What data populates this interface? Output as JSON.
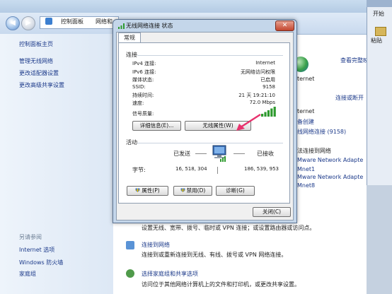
{
  "background_window": {
    "breadcrumb": [
      "控制面板",
      "网络和"
    ],
    "sidebar": {
      "home": "控制面板主页",
      "links": [
        "管理无线网络",
        "更改适配器设置",
        "更改高级共享设置"
      ],
      "see_also_title": "另请参阅",
      "see_also": [
        "Internet 选项",
        "Windows 防火墙",
        "家庭组"
      ]
    },
    "main": {
      "view_full_map": "查看完整映射",
      "connect_or_disconnect": "连接或断开",
      "internet_1": "ternet",
      "internet_2": "ternet",
      "homegroup": "备创建",
      "wireless_conn": "线网络连接 (9158)",
      "choose_network": "法连接到网络",
      "vm_adapter": "Mware Network Adapte",
      "vmnet1": "Mnet1",
      "vm_adapter2": "Mware Network Adapte",
      "vmnet8": "Mnet8",
      "setup_desc": "设置无线、宽带、拨号、临时或 VPN 连接；或设置路由器或访问点。",
      "connect_to_network": "连接到网络",
      "connect_desc": "连接到或重新连接到无线、有线、拨号或 VPN 网络连接。",
      "choose_homegroup": "选择家庭组和共享选项",
      "homegroup_desc": "访问位于其他网络计算机上的文件和打印机，或更改共享设置。"
    }
  },
  "right_window": {
    "start_label": "开始",
    "paste_label": "粘贴"
  },
  "dialog": {
    "title": "无线网络连接 状态",
    "tab": "常规",
    "connection_section": "连接",
    "rows": [
      {
        "label": "IPv4 连接:",
        "value": "Internet"
      },
      {
        "label": "IPv6 连接:",
        "value": "无网络访问权限"
      },
      {
        "label": "媒体状态:",
        "value": "已启用"
      },
      {
        "label": "SSID:",
        "value": "9158"
      },
      {
        "label": "持续时间:",
        "value": "21 天 19:21:10"
      },
      {
        "label": "速度:",
        "value": "72.0 Mbps"
      }
    ],
    "signal_label": "信号质量:",
    "signal_level": 5,
    "signal_max": 5,
    "details_button": "详细信息(E)...",
    "wireless_props_button": "无线属性(W)",
    "activity_section": "活动",
    "sent_label": "已发送",
    "received_label": "已接收",
    "bytes_label": "字节:",
    "bytes_sent": "16, 518, 304",
    "bytes_received": "186, 539, 953",
    "properties_button": "属性(P)",
    "disable_button": "禁用(D)",
    "diagnose_button": "诊断(G)",
    "close_button": "关闭(C)",
    "colors": {
      "link": "#1c3a8a",
      "signal_green": "#2e9a2e",
      "annotation_arrow": "#e8326e"
    }
  }
}
